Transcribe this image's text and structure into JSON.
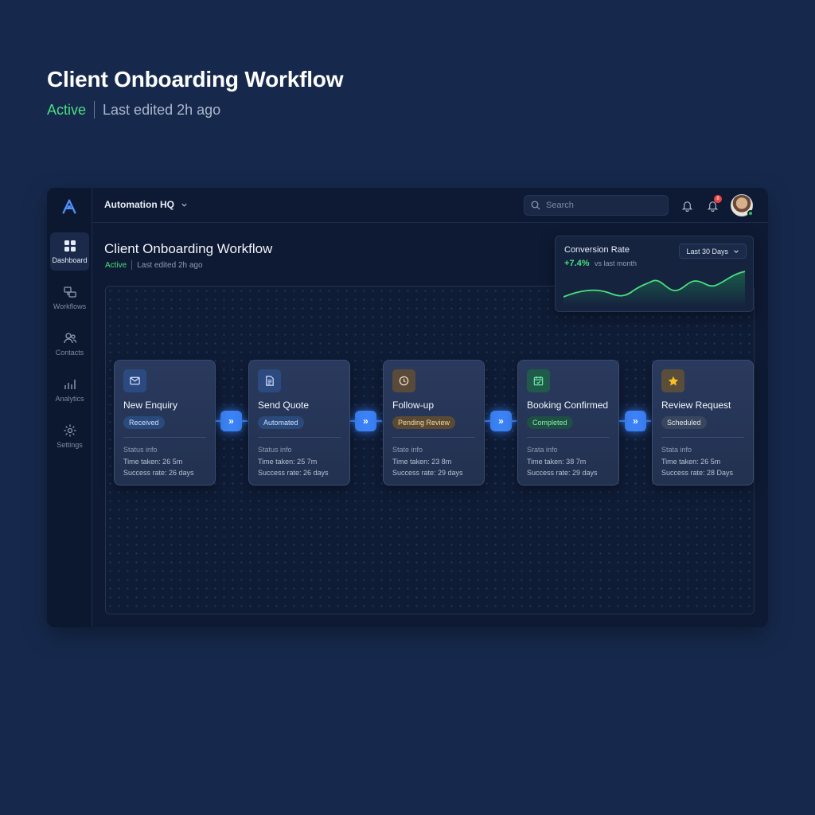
{
  "hero": {
    "title": "Client Onboarding Workflow",
    "status": "Active",
    "edited": "Last edited 2h ago"
  },
  "topbar": {
    "workspace": "Automation HQ",
    "search_placeholder": "Search",
    "notification_count": "8"
  },
  "sidebar": {
    "items": [
      {
        "label": "Dashboard",
        "icon": "grid-icon",
        "active": true
      },
      {
        "label": "Workflows",
        "icon": "workflow-icon",
        "active": false
      },
      {
        "label": "Contacts",
        "icon": "contacts-icon",
        "active": false
      },
      {
        "label": "Analytics",
        "icon": "analytics-icon",
        "active": false
      },
      {
        "label": "Settings",
        "icon": "gear-icon",
        "active": false
      }
    ]
  },
  "page": {
    "title": "Client Onboarding Workflow",
    "status": "Active",
    "edited": "Last edited 2h ago"
  },
  "conversion": {
    "title": "Conversion Rate",
    "delta": "+7.4%",
    "vs": "vs last month",
    "range": "Last 30 Days",
    "accent": "#4ade80"
  },
  "steps": [
    {
      "title": "New Enquiry",
      "badge": "Received",
      "icon": "mail-icon",
      "info_title": "Status info",
      "time": "Time taken: 26 5m",
      "rate": "Success rate: 26 days"
    },
    {
      "title": "Send Quote",
      "badge": "Automated",
      "icon": "document-icon",
      "info_title": "Status info",
      "time": "Time taken: 25 7m",
      "rate": "Success rate: 26 days"
    },
    {
      "title": "Follow-up",
      "badge": "Pending Review",
      "icon": "clock-icon",
      "info_title": "State info",
      "time": "Time taken: 23 8m",
      "rate": "Success rate: 29 days"
    },
    {
      "title": "Booking Confirmed",
      "badge": "Completed",
      "icon": "calendar-check-icon",
      "info_title": "Srata info",
      "time": "Time taken: 38 7m",
      "rate": "Success rate: 29 days"
    },
    {
      "title": "Review Request",
      "badge": "Scheduled",
      "icon": "star-icon",
      "info_title": "Stata info",
      "time": "Time taken: 26 5m",
      "rate": "Success rate: 28 Days"
    }
  ],
  "connector_label": "»"
}
